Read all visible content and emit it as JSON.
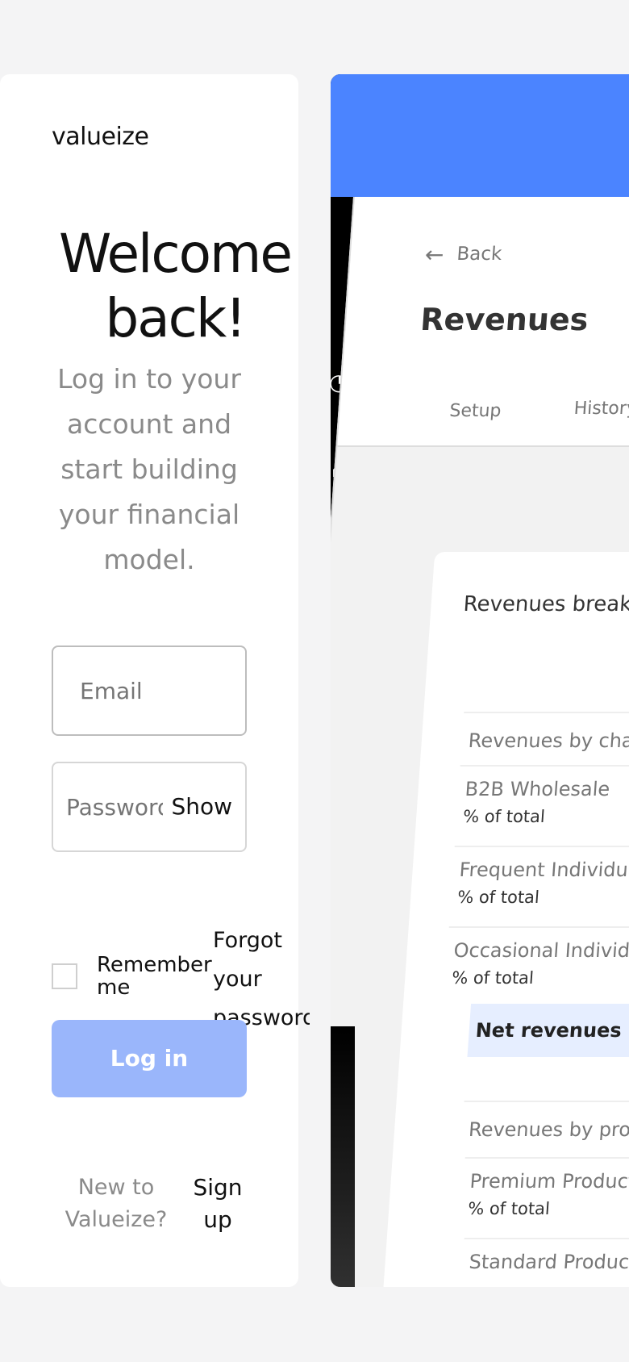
{
  "login": {
    "logo": "valueize",
    "welcome_title": "Welcome\nback!",
    "welcome_subtitle": "Log in to your account and start building your financial model.",
    "email_placeholder": "Email",
    "password_placeholder": "Password",
    "show_label": "Show",
    "remember_label": "Remember me",
    "forgot_label": "Forgot your password",
    "login_button": "Log in",
    "new_to_label": "New to Valueize?",
    "signup_label": "Sign up"
  },
  "preview": {
    "back_label": "Back",
    "page_title": "Revenues",
    "tabs": [
      "Setup",
      "History"
    ],
    "card_title": "Revenues breakdown",
    "section1_header": "Revenues by channel",
    "rows1": [
      {
        "name": "B2B Wholesale",
        "sub": "% of total"
      },
      {
        "name": "Frequent Individuals",
        "sub": "% of total"
      },
      {
        "name": "Occasional Individuals",
        "sub": "% of total"
      }
    ],
    "net_revenues": "Net revenues",
    "section2_header": "Revenues by product",
    "rows2": [
      {
        "name": "Premium Products",
        "sub": "% of total"
      },
      {
        "name": "Standard Products",
        "sub": ""
      }
    ],
    "colors": {
      "accent": "#4b84ff",
      "button_disabled": "#9ab6fb"
    }
  }
}
